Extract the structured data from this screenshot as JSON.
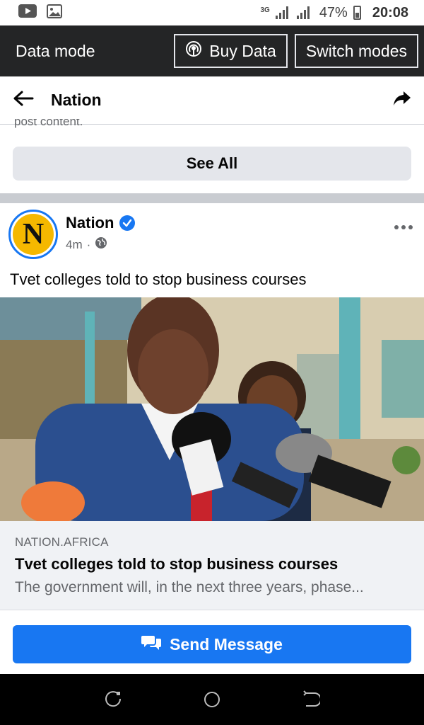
{
  "status_bar": {
    "network": "3G",
    "battery": "47%",
    "time": "20:08",
    "icons": [
      "youtube-icon",
      "gallery-icon",
      "signal-icon",
      "battery-icon"
    ]
  },
  "data_mode": {
    "label": "Data mode",
    "buy_label": "Buy Data",
    "switch_label": "Switch modes"
  },
  "header": {
    "title": "Nation"
  },
  "clipped_text": "post content.",
  "see_all_label": "See All",
  "post": {
    "author": "Nation",
    "avatar_letter": "N",
    "time": "4m",
    "text": "Tvet colleges told to stop business courses",
    "image_alt": "Speaker at press conference with microphones",
    "link": {
      "domain": "NATION.AFRICA",
      "title": "Tvet colleges told to stop business courses",
      "description": "The government will, in the next three years, phase..."
    }
  },
  "send_message_label": "Send Message",
  "colors": {
    "accent": "#1877f2",
    "dark_bar": "#242526",
    "avatar_bg": "#f5b800"
  }
}
